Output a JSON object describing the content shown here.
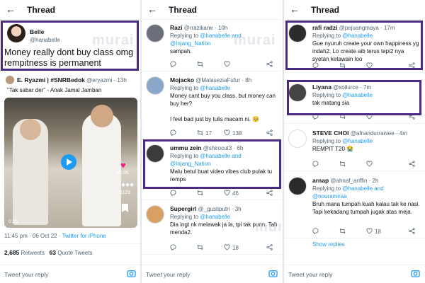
{
  "watermark": "murai",
  "header_title": "Thread",
  "reply_placeholder": "Tweet your reply",
  "col1": {
    "main": {
      "name": "Belle",
      "handle": "@hanabelle",
      "text": "Money really dont buy class omg rempitness is permanent"
    },
    "quote": {
      "name": "E. Ryazmi | #SNRBedok",
      "handle": "@eryazmi",
      "time": "13h",
      "text": "\"Tak sabar der\" - Anak Jamal Jamban"
    },
    "video": {
      "duration": "0:25",
      "likes": "45.0K",
      "comments": "1129"
    },
    "meta": {
      "time": "11:45 pm",
      "dot": "·",
      "date": "06 Oct 22",
      "via": "Twitter for iPhone"
    },
    "stats": {
      "retweets_num": "2,685",
      "retweets_label": "Retweets",
      "quotes_num": "63",
      "quotes_label": "Quote Tweets"
    }
  },
  "col2": {
    "tweets": [
      {
        "name": "Razi",
        "handle": "@rrazikane",
        "time": "10h",
        "replying": "Replying to",
        "to": "@hanabelle and @Injang_Nation",
        "text": "sampah.",
        "rt": "",
        "likes": "",
        "avatar_color": "#6b6f7a"
      },
      {
        "name": "Mojacko",
        "handle": "@MalaseziaFufur",
        "time": "8h",
        "replying": "Replying to",
        "to": "@hanabelle",
        "text": "Money cant buy you class, but money can buy her?\n\nI feel bad just by tulis macam ni. 🥺",
        "rt": "17",
        "likes": "138",
        "avatar_color": "#8aa6c8"
      },
      {
        "name": "ummu zein",
        "handle": "@shirocut3",
        "time": "6h",
        "replying": "Replying to",
        "to": "@hanabelle and @Injang_Nation",
        "text": "Malu betul buat video vibes club pulak tu remps",
        "rt": "",
        "likes": "46",
        "avatar_color": "#3b3b3b"
      },
      {
        "name": "Supergirl",
        "handle": "@_gustiputri",
        "time": "3h",
        "replying": "Replying to",
        "to": "@hanabelle",
        "text": "Dia ingt nk melawak ja la, tpi tak punn. Tah menda2.",
        "rt": "",
        "likes": "18",
        "avatar_color": "#d9a066"
      }
    ]
  },
  "col3": {
    "tweets": [
      {
        "name": "rafi radzi",
        "handle": "@pejuangmaya",
        "time": "17m",
        "replying": "Replying to",
        "to": "@hanabelle",
        "text": "Gue nyuruh create your own happiness yg indah2. Lo create aib terus tepi2 nya syetan ketawain loo",
        "rt": "",
        "likes": "",
        "avatar_color": "#2c2c2c"
      },
      {
        "name": "Liyana",
        "handle": "@xoilurce",
        "time": "7m",
        "replying": "Replying to",
        "to": "@hanabelle",
        "text": "tak matang sia",
        "rt": "",
        "likes": "",
        "avatar_color": "#444"
      },
      {
        "name": "STEVE CHOI",
        "handle": "@afnandurraniee",
        "time": "4m",
        "replying": "Replying to",
        "to": "@hanabelle",
        "text": "REMPIT T20 😭",
        "rt": "",
        "likes": "",
        "avatar_color": "#fff"
      },
      {
        "name": "arnap",
        "handle": "@ahnaf_ariffin",
        "time": "2h",
        "replying": "Replying to",
        "to": "@hanabelle and @nouramiraa",
        "text": "Bruh mana tumpah kuah kalau tak ke nasi. Tapi kekadang tumpah jugak atas meja.",
        "rt": "",
        "likes": "18",
        "avatar_color": "#2a2a2a"
      }
    ],
    "show_replies": "Show replies"
  },
  "colors": {
    "frame": "#4b2a84",
    "blue": "#1d9bf0",
    "gray": "#536471"
  }
}
